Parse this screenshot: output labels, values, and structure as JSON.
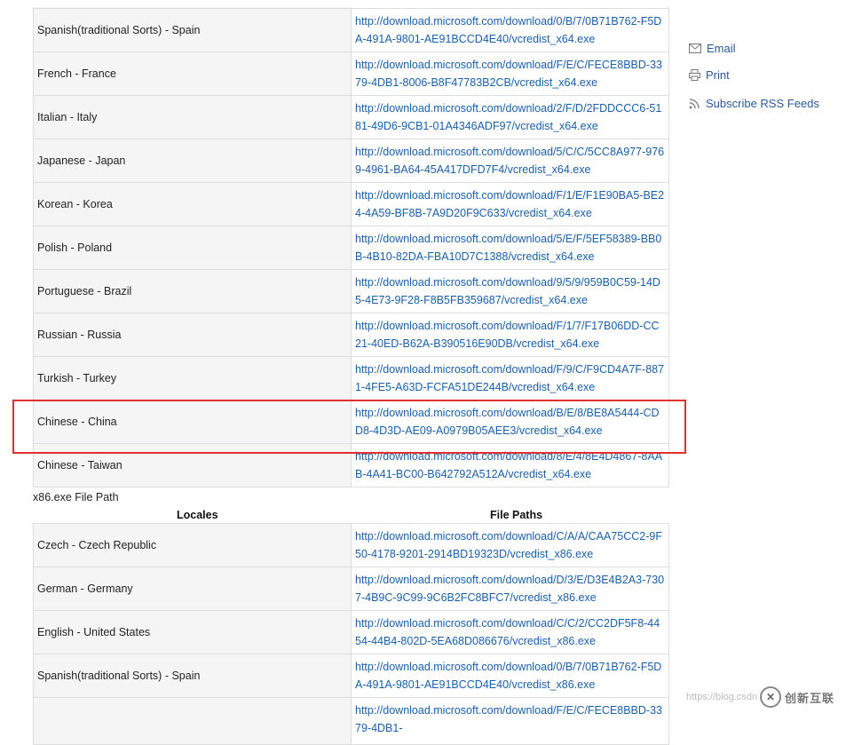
{
  "sidebar": {
    "email_label": "Email",
    "print_label": "Print",
    "rss_label": "Subscribe RSS Feeds"
  },
  "x64_rows": [
    {
      "locale": "Spanish(traditional Sorts) - Spain",
      "path": "http://download.microsoft.com/download/0/B/7/0B71B762-F5DA-491A-9801-AE91BCCD4E40/vcredist_x64.exe"
    },
    {
      "locale": "French - France",
      "path": "http://download.microsoft.com/download/F/E/C/FECE8BBD-3379-4DB1-8006-B8F47783B2CB/vcredist_x64.exe"
    },
    {
      "locale": "Italian - Italy",
      "path": "http://download.microsoft.com/download/2/F/D/2FDDCCC6-5181-49D6-9CB1-01A4346ADF97/vcredist_x64.exe"
    },
    {
      "locale": "Japanese - Japan",
      "path": "http://download.microsoft.com/download/5/C/C/5CC8A977-9769-4961-BA64-45A417DFD7F4/vcredist_x64.exe"
    },
    {
      "locale": "Korean - Korea",
      "path": "http://download.microsoft.com/download/F/1/E/F1E90BA5-BE24-4A59-BF8B-7A9D20F9C633/vcredist_x64.exe"
    },
    {
      "locale": "Polish - Poland",
      "path": "http://download.microsoft.com/download/5/E/F/5EF58389-BB0B-4B10-82DA-FBA10D7C1388/vcredist_x64.exe"
    },
    {
      "locale": "Portuguese - Brazil",
      "path": "http://download.microsoft.com/download/9/5/9/959B0C59-14D5-4E73-9F28-F8B5FB359687/vcredist_x64.exe"
    },
    {
      "locale": "Russian - Russia",
      "path": "http://download.microsoft.com/download/F/1/7/F17B06DD-CC21-40ED-B62A-B390516E90DB/vcredist_x64.exe"
    },
    {
      "locale": "Turkish - Turkey",
      "path": "http://download.microsoft.com/download/F/9/C/F9CD4A7F-8871-4FE5-A63D-FCFA51DE244B/vcredist_x64.exe"
    },
    {
      "locale": "Chinese - China",
      "path": "http://download.microsoft.com/download/B/E/8/BE8A5444-CDD8-4D3D-AE09-A0979B05AEE3/vcredist_x64.exe"
    },
    {
      "locale": "Chinese - Taiwan",
      "path": "http://download.microsoft.com/download/8/E/4/8E4D4867-8AAB-4A41-BC00-B642792A512A/vcredist_x64.exe"
    }
  ],
  "x86_caption": "x86.exe File Path",
  "headers": {
    "locales": "Locales",
    "file_paths": "File Paths"
  },
  "x86_rows": [
    {
      "locale": "Czech - Czech Republic",
      "path": "http://download.microsoft.com/download/C/A/A/CAA75CC2-9F50-4178-9201-2914BD19323D/vcredist_x86.exe"
    },
    {
      "locale": "German - Germany",
      "path": "http://download.microsoft.com/download/D/3/E/D3E4B2A3-7307-4B9C-9C99-9C6B2FC8BFC7/vcredist_x86.exe"
    },
    {
      "locale": "English - United States",
      "path": "http://download.microsoft.com/download/C/C/2/CC2DF5F8-4454-44B4-802D-5EA68D086676/vcredist_x86.exe"
    },
    {
      "locale": "Spanish(traditional Sorts) - Spain",
      "path": "http://download.microsoft.com/download/0/B/7/0B71B762-F5DA-491A-9801-AE91BCCD4E40/vcredist_x86.exe"
    },
    {
      "locale": "",
      "path": "http://download.microsoft.com/download/F/E/C/FECE8BBD-3379-4DB1-"
    }
  ],
  "watermark": {
    "url_text": "https://blog.csdn",
    "brand": "创新互联"
  },
  "colors": {
    "link": "#1a5fa8",
    "highlight": "#e03030",
    "sidebar_link": "#2a5a96"
  }
}
